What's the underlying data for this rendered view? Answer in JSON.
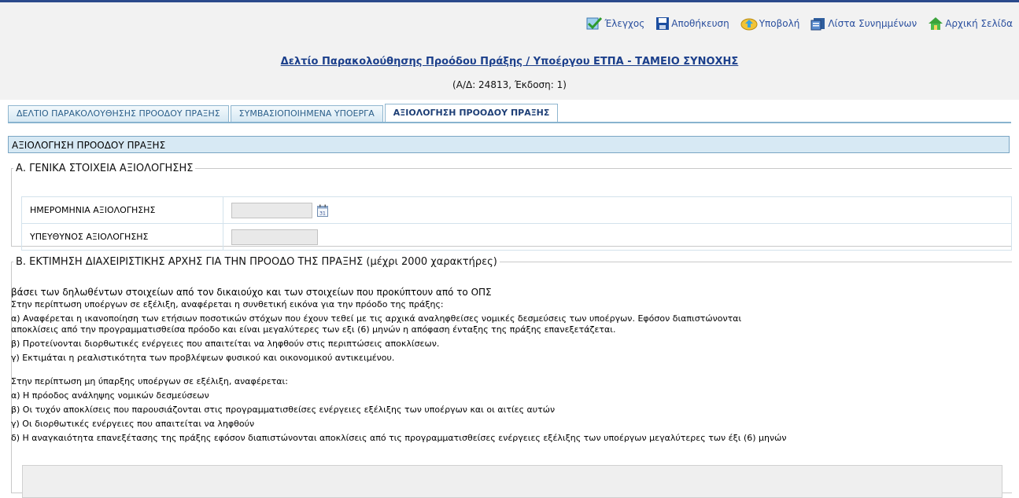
{
  "toolbar": {
    "check_label": "Έλεγχος",
    "save_label": "Αποθήκευση",
    "submit_label": "Υποβολή",
    "attachments_label": "Λίστα Συνημμένων",
    "home_label": "Αρχική Σελίδα"
  },
  "header": {
    "title": "Δελτίο Παρακολούθησης Προόδου Πράξης / Υποέργου ΕΤΠΑ - ΤΑΜΕΙΟ ΣΥΝΟΧΗΣ",
    "subtitle": "(Α/Δ: 24813, Έκδοση: 1)"
  },
  "tabs": [
    {
      "label": "ΔΕΛΤΙΟ ΠΑΡΑΚΟΛΟΥΘΗΣΗΣ ΠΡΟΟΔΟΥ ΠΡΑΞΗΣ"
    },
    {
      "label": "ΣΥΜΒΑΣΙΟΠΟΙΗΜΕΝΑ ΥΠΟΕΡΓΑ"
    },
    {
      "label": "ΑΞΙΟΛΟΓΗΣΗ ΠΡΟΟΔΟΥ ΠΡΑΞΗΣ"
    }
  ],
  "section_title": "ΑΞΙΟΛΟΓΗΣΗ ΠΡΟΟΔΟΥ ΠΡΑΞΗΣ",
  "section_a": {
    "legend": "Α. ΓΕΝΙΚΑ ΣΤΟΙΧΕΙΑ ΑΞΙΟΛΟΓΗΣΗΣ",
    "date_label": "ΗΜΕΡΟΜΗΝΙΑ ΑΞΙΟΛΟΓΗΣΗΣ",
    "date_value": "",
    "responsible_label": "ΥΠΕΥΘΥΝΟΣ ΑΞΙΟΛΟΓΗΣΗΣ",
    "responsible_value": ""
  },
  "section_b": {
    "legend": "Β. ΕΚΤΙΜΗΣΗ ΔΙΑΧΕΙΡΙΣΤΙΚΗΣ ΑΡΧΗΣ ΓΙΑ ΤΗΝ ΠΡΟΟΔΟ ΤΗΣ ΠΡΑΞΗΣ (μέχρι 2000 χαρακτήρες)",
    "intro": "βάσει των δηλωθέντων στοιχείων από τον δικαιούχο και των στοιχείων που προκύπτουν από το ΟΠΣ",
    "l1": "Στην περίπτωση υποέργων σε εξέλιξη, αναφέρεται η συνθετική εικόνα για την πρόοδο της πράξης:",
    "l2": "α) Αναφέρεται η ικανοποίηση των ετήσιων ποσοτικών στόχων που έχουν τεθεί με τις αρχικά αναληφθείσες νομικές δεσμεύσεις των υποέργων. Εφόσον διαπιστώνονται",
    "l3": "αποκλίσεις από την προγραμματισθείσα πρόοδο και είναι μεγαλύτερες των εξι (6) μηνών η απόφαση ένταξης της πράξης επανεξετάζεται.",
    "l4": "β) Προτείνονται διορθωτικές ενέργειες που απαιτείται να ληφθούν στις περιπτώσεις αποκλίσεων.",
    "l5": "γ) Εκτιμάται η ρεαλιστικότητα των προβλέψεων φυσικού και οικονομικού αντικειμένου.",
    "l6": "Στην περίπτωση μη ύπαρξης υποέργων σε εξέλιξη, αναφέρεται:",
    "l7": "α) Η πρόοδος ανάληψης νομικών δεσμεύσεων",
    "l8": "β) Οι τυχόν αποκλίσεις που παρουσιάζονται στις προγραμματισθείσες ενέργειες εξέλιξης των υποέργων και οι αιτίες αυτών",
    "l9": "γ) Οι διορθωτικές ενέργειες που απαιτείται να ληφθούν",
    "l10": "δ) Η αναγκαιότητα επανεξέτασης της πράξης εφόσον διαπιστώνονται αποκλίσεις από τις προγραμματισθείσες ενέργειες εξέλιξης των υποέργων μεγαλύτερες των έξι (6) μηνών",
    "textarea_value": ""
  },
  "calendar_day": "31"
}
